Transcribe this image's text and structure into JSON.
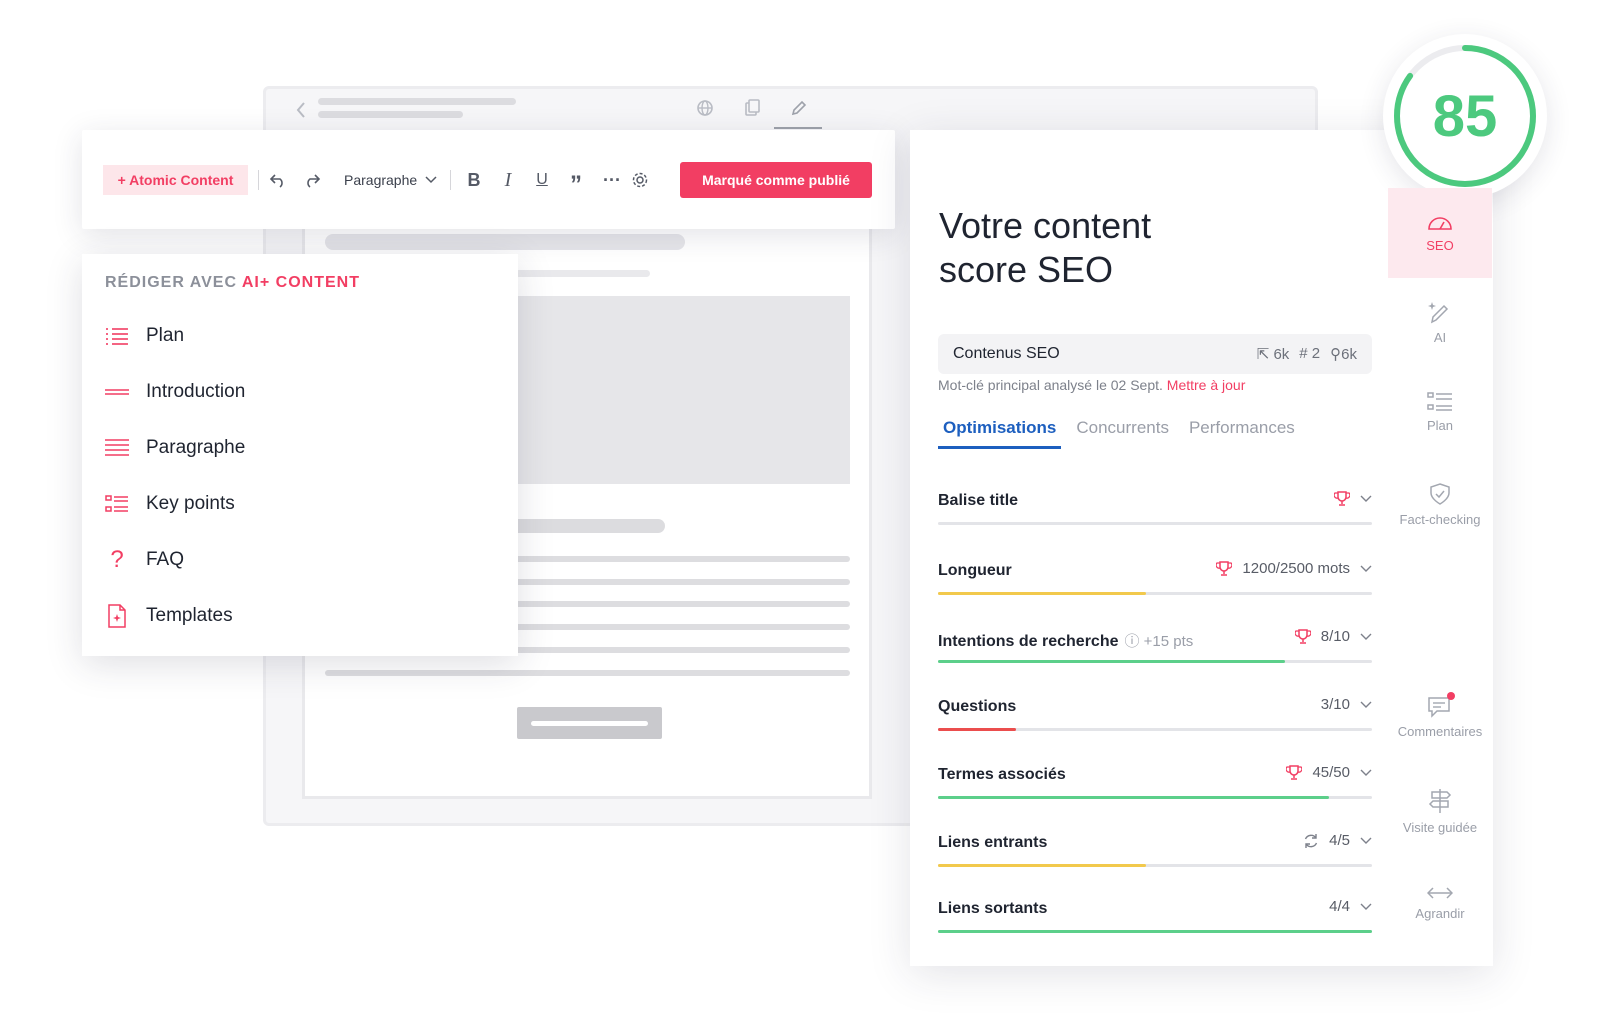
{
  "toolbar": {
    "atomic_label": "+ Atomic Content",
    "paragraph_select": "Paragraphe",
    "publish_label": "Marqué comme publié"
  },
  "ai_menu": {
    "title_prefix": "RÉDIGER AVEC",
    "title_accent": "AI+ CONTENT",
    "items": [
      {
        "label": "Plan",
        "icon": "list-icon"
      },
      {
        "label": "Introduction",
        "icon": "lines-icon"
      },
      {
        "label": "Paragraphe",
        "icon": "paragraph-icon"
      },
      {
        "label": "Key points",
        "icon": "keypoints-icon"
      },
      {
        "label": "FAQ",
        "icon": "question-icon"
      },
      {
        "label": "Templates",
        "icon": "template-icon"
      }
    ]
  },
  "score": {
    "value": "85",
    "percent": 85
  },
  "seo": {
    "title_line1": "Votre content",
    "title_line2": "score SEO",
    "keyword": "Contenus SEO",
    "stats": {
      "clicks": "6k",
      "rank": "# 2",
      "searches": "6k"
    },
    "note": "Mot-clé principal analysé le 02 Sept.",
    "update_link": "Mettre à jour",
    "tabs": [
      "Optimisations",
      "Concurrents",
      "Performances"
    ],
    "metrics": [
      {
        "name": "Balise title",
        "extra": "",
        "value": "",
        "trophy": true,
        "refresh": false,
        "fill": 0,
        "color": "#e3e4e8"
      },
      {
        "name": "Longueur",
        "extra": "",
        "value": "1200/2500 mots",
        "trophy": true,
        "refresh": false,
        "fill": 0.48,
        "color": "#f2c94c"
      },
      {
        "name": "Intentions de recherche",
        "extra": "+15 pts",
        "value": "8/10",
        "trophy": true,
        "refresh": false,
        "fill": 0.8,
        "color": "#5ccf8a"
      },
      {
        "name": "Questions",
        "extra": "",
        "value": "3/10",
        "trophy": false,
        "refresh": false,
        "fill": 0.18,
        "color": "#eb4d4d"
      },
      {
        "name": "Termes associés",
        "extra": "",
        "value": "45/50",
        "trophy": true,
        "refresh": false,
        "fill": 0.9,
        "color": "#5ccf8a"
      },
      {
        "name": "Liens entrants",
        "extra": "",
        "value": "4/5",
        "trophy": false,
        "refresh": true,
        "fill": 0.48,
        "color": "#f2c94c"
      },
      {
        "name": "Liens sortants",
        "extra": "",
        "value": "4/4",
        "trophy": false,
        "refresh": false,
        "fill": 1.0,
        "color": "#5ccf8a"
      }
    ]
  },
  "sidebar": {
    "items": [
      {
        "label": "SEO",
        "icon": "gauge-icon"
      },
      {
        "label": "AI",
        "icon": "magic-pen-icon"
      },
      {
        "label": "Plan",
        "icon": "outline-icon"
      },
      {
        "label": "Fact-checking",
        "icon": "shield-check-icon"
      },
      {
        "label": "Commentaires",
        "icon": "comment-icon"
      },
      {
        "label": "Visite guidée",
        "icon": "signpost-icon"
      },
      {
        "label": "Agrandir",
        "icon": "expand-icon"
      }
    ]
  }
}
